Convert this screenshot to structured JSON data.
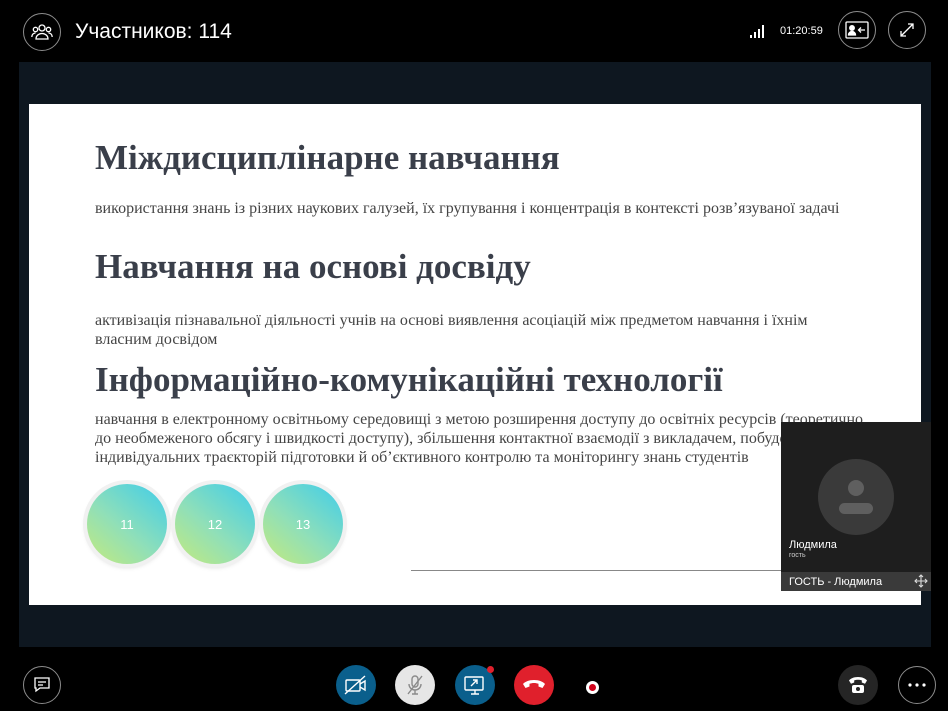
{
  "header": {
    "participants_label": "Участников: 114",
    "call_time": "01:20:59"
  },
  "slide": {
    "heading_1": "Міждисциплінарне навчання",
    "text_1": "використання знань із різних наукових галузей, їх групування і концентрація в контексті розв’язуваної задачі",
    "heading_2": "Навчання на основі досвіду",
    "text_2": "активізація пізнавальної діяльності учнів на основі виявлення асоціацій між предметом навчання і їхнім власним досвідом",
    "heading_3": "Інформаційно-комунікаційні технології",
    "text_3": "навчання в електронному освітньому середовищі з метою розширення доступу до освітніх ресурсів (теоретично до необмеженого обсягу і швидкості доступу), збільшення контактної взаємодії з викладачем, побудови індивідуальних траєкторій підготовки й об’єктивного контролю та моніторингу знань студентів",
    "bubbles": [
      "11",
      "12",
      "13"
    ]
  },
  "self_view": {
    "name": "Людмила",
    "role": "гость",
    "caption": "ГОСТЬ - Людмила"
  },
  "icons": {
    "participants": "people-icon",
    "signal": "signal-bars-icon",
    "video_layout": "contact-card-icon",
    "fullscreen": "expand-icon",
    "chat": "chat-bubble-icon",
    "camera": "camera-off-icon",
    "mic": "mic-off-icon",
    "share": "share-screen-icon",
    "hangup": "phone-hangup-icon",
    "record": "record-icon",
    "dialpad": "phone-icon",
    "more": "more-dots-icon",
    "move": "move-icon"
  },
  "colors": {
    "accent_blue": "#0a5f8c",
    "hangup_red": "#e0202c",
    "slide_text": "#3a3f4a",
    "record_red": "#d0021b"
  }
}
